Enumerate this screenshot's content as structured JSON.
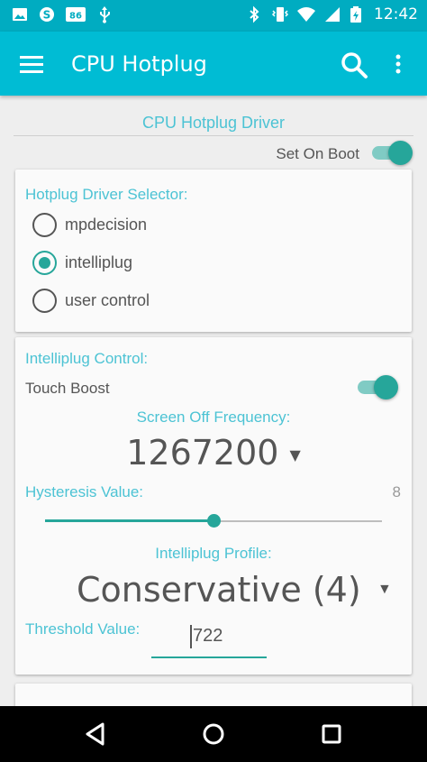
{
  "status_bar": {
    "time": "12:42",
    "left_icons": [
      "image-icon",
      "skype-icon",
      "notification-badge-icon",
      "usb-icon"
    ],
    "right_icons": [
      "bluetooth-icon",
      "vibrate-icon",
      "wifi-icon",
      "signal-icon",
      "battery-icon"
    ]
  },
  "app_bar": {
    "title": "CPU Hotplug",
    "menu_icon": "hamburger-menu-icon",
    "search_icon": "search-icon",
    "more_icon": "more-vert-icon",
    "color": "#00bcd4"
  },
  "section": {
    "title": "CPU Hotplug Driver",
    "set_on_boot_label": "Set On Boot",
    "set_on_boot": true
  },
  "driver_selector": {
    "title": "Hotplug Driver Selector:",
    "options": [
      {
        "label": "mpdecision",
        "selected": false
      },
      {
        "label": "intelliplug",
        "selected": true
      },
      {
        "label": "user control",
        "selected": false
      }
    ]
  },
  "intelliplug": {
    "title": "Intelliplug Control:",
    "touch_boost_label": "Touch Boost",
    "touch_boost": true,
    "screen_off_label": "Screen Off Frequency:",
    "screen_off_value": "1267200",
    "hysteresis_label": "Hysteresis Value:",
    "hysteresis_value": "8",
    "hysteresis_fraction": 0.5,
    "profile_label": "Intelliplug Profile:",
    "profile_value": "Conservative (4)",
    "threshold_label": "Threshold Value:",
    "threshold_value": "722"
  },
  "colors": {
    "accent": "#26a69a",
    "label": "#4cc3d4",
    "status_bar": "#00acc1"
  },
  "nav_bar": {
    "back_icon": "back-triangle-icon",
    "home_icon": "home-circle-icon",
    "recents_icon": "recents-square-icon"
  }
}
